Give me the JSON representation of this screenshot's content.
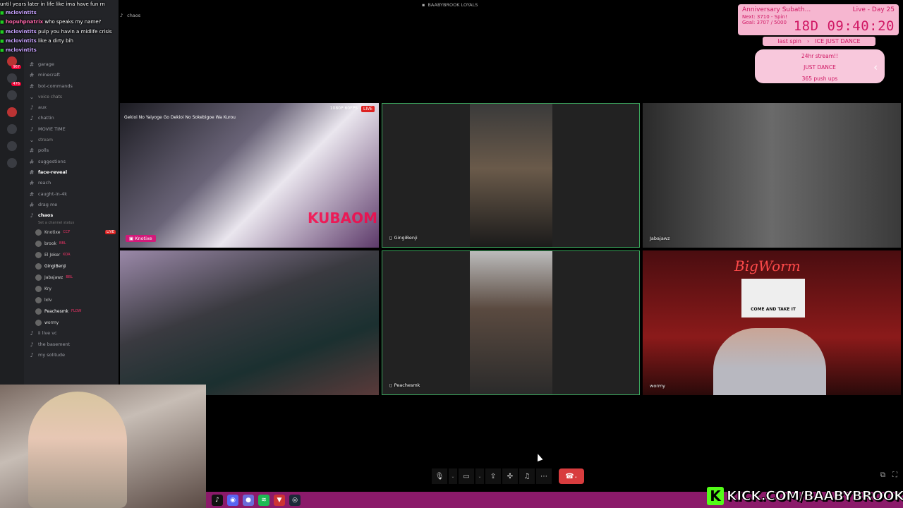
{
  "window_title": "BAABYBROOK LOYALS",
  "call_channel": "chaos",
  "chat": [
    {
      "user": "",
      "text": "until years later in life like ima have fun rn"
    },
    {
      "user": "mclovintits",
      "text": ""
    },
    {
      "user": "hopuhpnatrix",
      "text": "who speaks my name?"
    },
    {
      "user": "mclovintits",
      "text": "pulp you havin a midlife crisis"
    },
    {
      "user": "mclovintits",
      "text": "like a dirty bih"
    },
    {
      "user": "mclovintits",
      "text": ""
    }
  ],
  "server_badges": [
    "967",
    "476"
  ],
  "channels": [
    {
      "type": "text",
      "name": "garage"
    },
    {
      "type": "text",
      "name": "minecraft"
    },
    {
      "type": "text",
      "name": "bot-commands"
    },
    {
      "type": "category",
      "name": "voice chats"
    },
    {
      "type": "voice",
      "name": "aux"
    },
    {
      "type": "voice",
      "name": "chattin"
    },
    {
      "type": "voice",
      "name": "MOVIE TIME"
    },
    {
      "type": "category",
      "name": "stream"
    },
    {
      "type": "text",
      "name": "polls"
    },
    {
      "type": "text",
      "name": "suggestions"
    },
    {
      "type": "text",
      "name": "face-reveal",
      "bold": true
    },
    {
      "type": "text",
      "name": "reach"
    },
    {
      "type": "text",
      "name": "caught-in-4k"
    },
    {
      "type": "text",
      "name": "drag me"
    },
    {
      "type": "voice",
      "name": "chaos",
      "bold": true
    }
  ],
  "channel_status": "Set a channel status",
  "voice_users": [
    {
      "name": "Knotixe",
      "tag": "CCF",
      "live": "LIVE"
    },
    {
      "name": "brook",
      "tag": "BBL"
    },
    {
      "name": "El Joker",
      "tag": "KOA"
    },
    {
      "name": "GingiBenji",
      "tag": ""
    },
    {
      "name": "Jabajawz",
      "tag": "BBL"
    },
    {
      "name": "Kry",
      "tag": ""
    },
    {
      "name": "lxlv",
      "tag": ""
    },
    {
      "name": "Peachesmk",
      "tag": "FLOW"
    },
    {
      "name": "wormy",
      "tag": ""
    }
  ],
  "channels_after": [
    {
      "type": "voice",
      "name": "ii live vc"
    },
    {
      "type": "voice",
      "name": "the basement"
    },
    {
      "type": "voice",
      "name": "my solitude"
    }
  ],
  "subathon": {
    "title": "Anniversary Subath...",
    "live_day": "Live - Day 25",
    "next": "Next: 3710 - Spin!",
    "goal": "Goal: 3707 / 5000",
    "timer": "18D 09:40:20",
    "last_spin_label": "last spin",
    "last_spin_value": "ICE JUST DANCE"
  },
  "goals_panel": [
    "24hr stream!!",
    "JUST DANCE",
    "365 push ups"
  ],
  "tiles": [
    {
      "name": "Knotixe",
      "live": "LIVE",
      "fps": "1080P 60FPS",
      "stream_title": "Gekioi No Yaiyoge Go Dekioi No Sokebigoe Wa Kurou",
      "watermark": "KUBAOM"
    },
    {
      "name": "GingiBenji"
    },
    {
      "name": "Jabajawz"
    },
    {
      "name": "",
      "name_note": "keyboard cam"
    },
    {
      "name": "Peachesmk"
    },
    {
      "name": "wormy",
      "sign_top": "BigWorm",
      "sign_text": "COME AND TAKE IT"
    }
  ],
  "controls": {
    "mic": "mic-icon",
    "camera": "camera-off-icon",
    "share": "screen-share-icon",
    "activities": "activities-icon",
    "soundboard": "soundboard-icon",
    "more": "more-icon",
    "end": "hangup-icon"
  },
  "kick_url": "KICK.COM/BAABYBROOK",
  "colors": {
    "accent": "#d01864",
    "kick": "#53fc18",
    "end_call": "#d83c3e",
    "speaking": "#3ba55d"
  }
}
